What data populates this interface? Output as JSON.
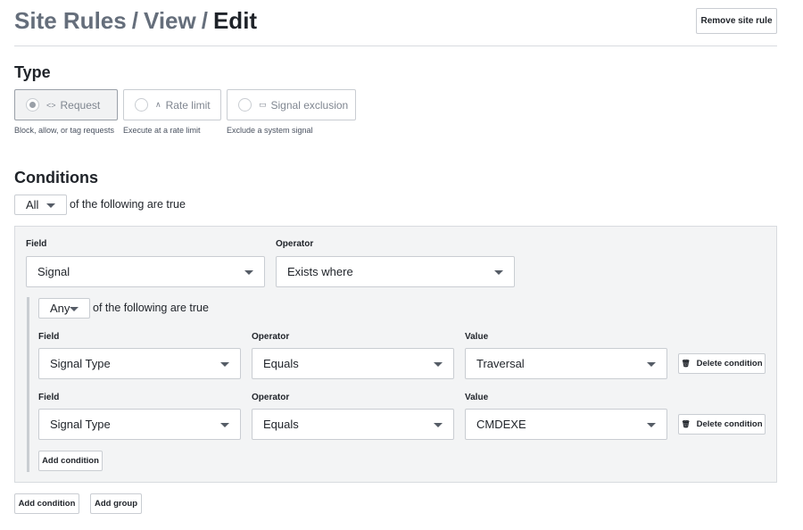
{
  "header": {
    "crumbs": [
      "Site Rules",
      "View"
    ],
    "separator": "/",
    "current": "Edit",
    "remove_button": "Remove site rule"
  },
  "type_section": {
    "title": "Type",
    "options": [
      {
        "label": "Request",
        "icon": "code-icon",
        "glyph": "<>",
        "description": "Block, allow, or tag requests",
        "selected": true
      },
      {
        "label": "Rate limit",
        "icon": "rate-limit-icon",
        "glyph": "⌃",
        "description": "Execute at a rate limit",
        "selected": false
      },
      {
        "label": "Signal exclusion",
        "icon": "tag-icon",
        "glyph": "◻",
        "description": "Exclude a system signal",
        "selected": false
      }
    ]
  },
  "conditions_section": {
    "title": "Conditions",
    "match_select": "All",
    "match_text": "of the following are true",
    "group": {
      "field_label": "Field",
      "field_value": "Signal",
      "operator_label": "Operator",
      "operator_value": "Exists where",
      "nested": {
        "match_select": "Any",
        "match_text": "of the following are true",
        "rows": [
          {
            "field_label": "Field",
            "field_value": "Signal Type",
            "operator_label": "Operator",
            "operator_value": "Equals",
            "value_label": "Value",
            "value": "Traversal",
            "delete_label": "Delete condition"
          },
          {
            "field_label": "Field",
            "field_value": "Signal Type",
            "operator_label": "Operator",
            "operator_value": "Equals",
            "value_label": "Value",
            "value": "CMDEXE",
            "delete_label": "Delete condition"
          }
        ],
        "add_condition_label": "Add condition"
      }
    },
    "add_condition_label": "Add condition",
    "add_group_label": "Add group"
  },
  "colors": {
    "muted_crumb": "#656e7b",
    "panel_bg": "#f3f4f5",
    "border": "#c9cdd2"
  }
}
